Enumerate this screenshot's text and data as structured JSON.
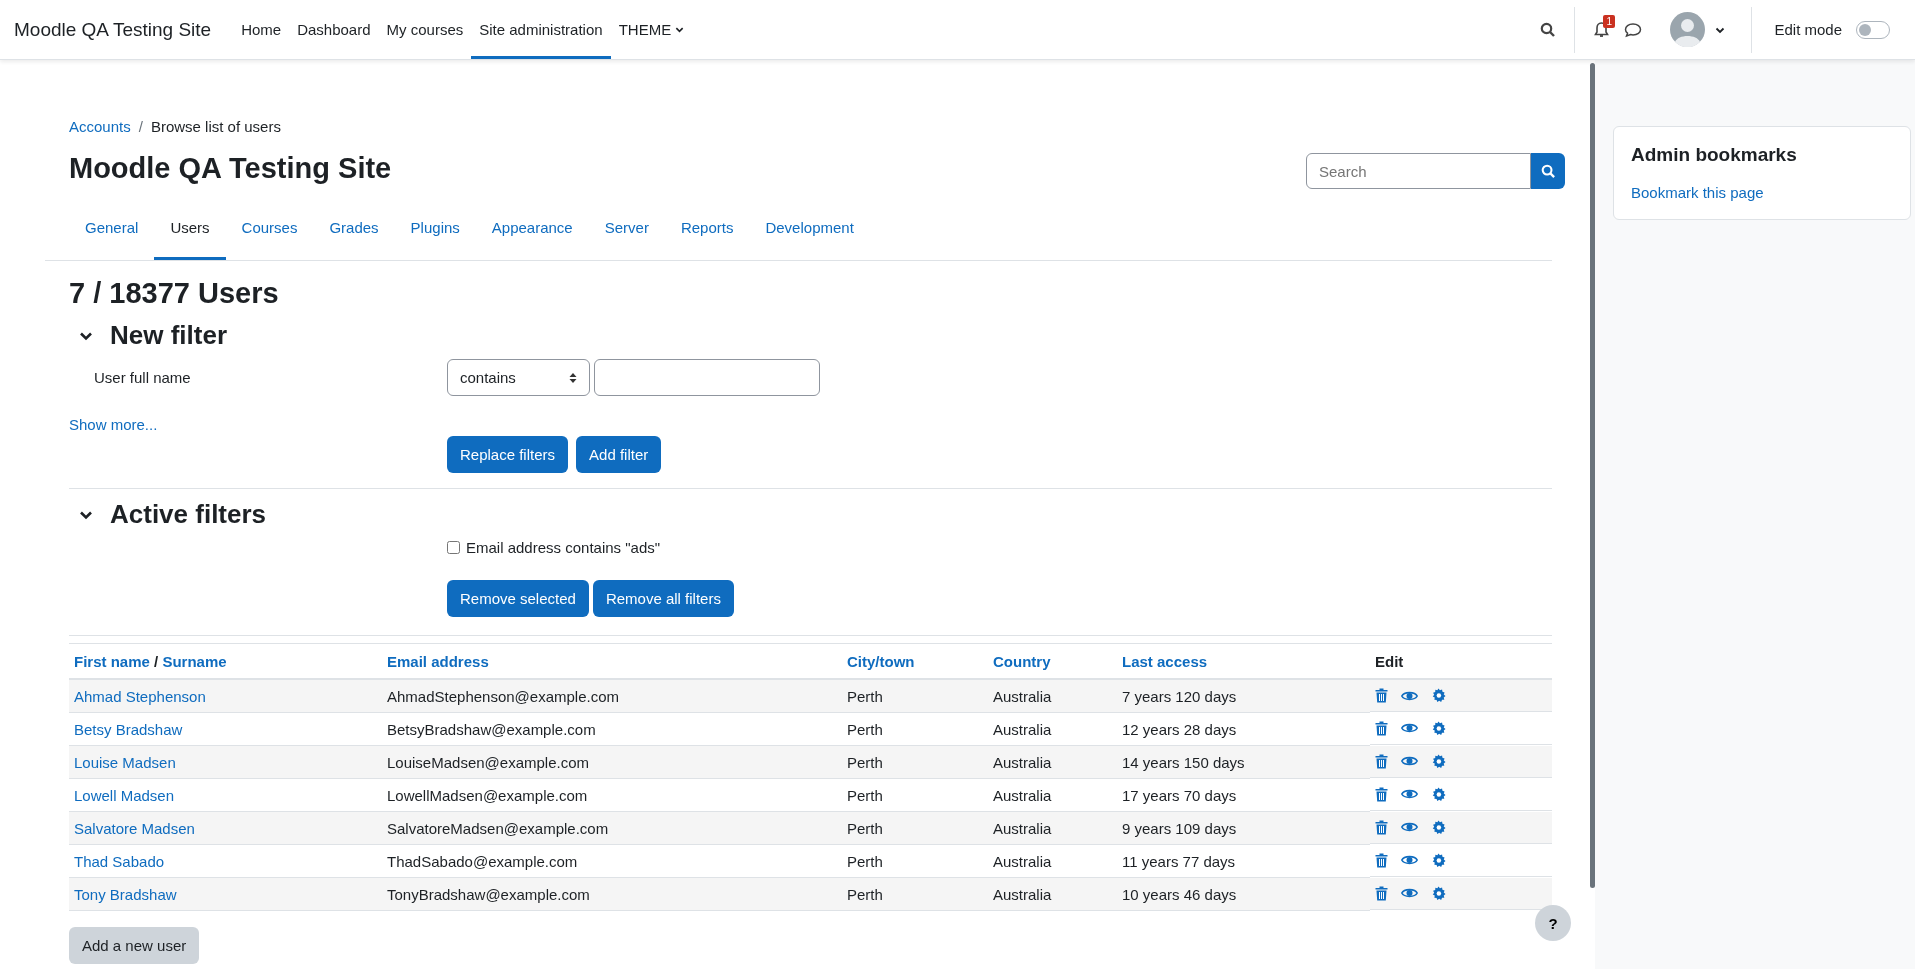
{
  "navbar": {
    "brand": "Moodle QA Testing Site",
    "items": [
      {
        "label": "Home",
        "selected": false,
        "dropdown": false
      },
      {
        "label": "Dashboard",
        "selected": false,
        "dropdown": false
      },
      {
        "label": "My courses",
        "selected": false,
        "dropdown": false
      },
      {
        "label": "Site administration",
        "selected": true,
        "dropdown": false
      },
      {
        "label": "THEME",
        "selected": false,
        "dropdown": true
      }
    ],
    "notification_count": "1",
    "edit_mode": {
      "label": "Edit mode",
      "on": false
    }
  },
  "breadcrumb": {
    "separator": "/",
    "items": [
      {
        "label": "Accounts",
        "link": true
      },
      {
        "label": "Browse list of users",
        "link": false
      }
    ]
  },
  "page_title": "Moodle QA Testing Site",
  "search": {
    "placeholder": "Search"
  },
  "tabs": [
    {
      "label": "General",
      "selected": false
    },
    {
      "label": "Users",
      "selected": true
    },
    {
      "label": "Courses",
      "selected": false
    },
    {
      "label": "Grades",
      "selected": false
    },
    {
      "label": "Plugins",
      "selected": false
    },
    {
      "label": "Appearance",
      "selected": false
    },
    {
      "label": "Server",
      "selected": false
    },
    {
      "label": "Reports",
      "selected": false
    },
    {
      "label": "Development",
      "selected": false
    }
  ],
  "users_heading": "7 / 18377 Users",
  "new_filter": {
    "heading": "New filter",
    "expanded": true,
    "field_label": "User full name",
    "operator": "contains",
    "show_more": "Show more...",
    "buttons": [
      "Replace filters",
      "Add filter"
    ]
  },
  "active_filters": {
    "heading": "Active filters",
    "expanded": true,
    "filters": [
      {
        "label": "Email address contains \"ads\"",
        "checked": false
      }
    ],
    "buttons": [
      "Remove selected",
      "Remove all filters"
    ]
  },
  "table": {
    "columns": [
      {
        "kind": "sort_pair",
        "labels": [
          "First name",
          "Surname"
        ],
        "separator": "/"
      },
      {
        "kind": "sort",
        "label": "Email address"
      },
      {
        "kind": "sort",
        "label": "City/town"
      },
      {
        "kind": "sort",
        "label": "Country"
      },
      {
        "kind": "sort",
        "label": "Last access"
      },
      {
        "kind": "plain",
        "label": "Edit"
      }
    ],
    "rows": [
      [
        "Ahmad Stephenson",
        "AhmadStephenson@example.com",
        "Perth",
        "Australia",
        "7 years 120 days"
      ],
      [
        "Betsy Bradshaw",
        "BetsyBradshaw@example.com",
        "Perth",
        "Australia",
        "12 years 28 days"
      ],
      [
        "Louise Madsen",
        "LouiseMadsen@example.com",
        "Perth",
        "Australia",
        "14 years 150 days"
      ],
      [
        "Lowell Madsen",
        "LowellMadsen@example.com",
        "Perth",
        "Australia",
        "17 years 70 days"
      ],
      [
        "Salvatore Madsen",
        "SalvatoreMadsen@example.com",
        "Perth",
        "Australia",
        "9 years 109 days"
      ],
      [
        "Thad Sabado",
        "ThadSabado@example.com",
        "Perth",
        "Australia",
        "11 years 77 days"
      ],
      [
        "Tony Bradshaw",
        "TonyBradshaw@example.com",
        "Perth",
        "Australia",
        "10 years 46 days"
      ]
    ]
  },
  "add_user_button": "Add a new user",
  "help_button": "?",
  "admin_bookmarks": {
    "title": "Admin bookmarks",
    "link": "Bookmark this page"
  }
}
